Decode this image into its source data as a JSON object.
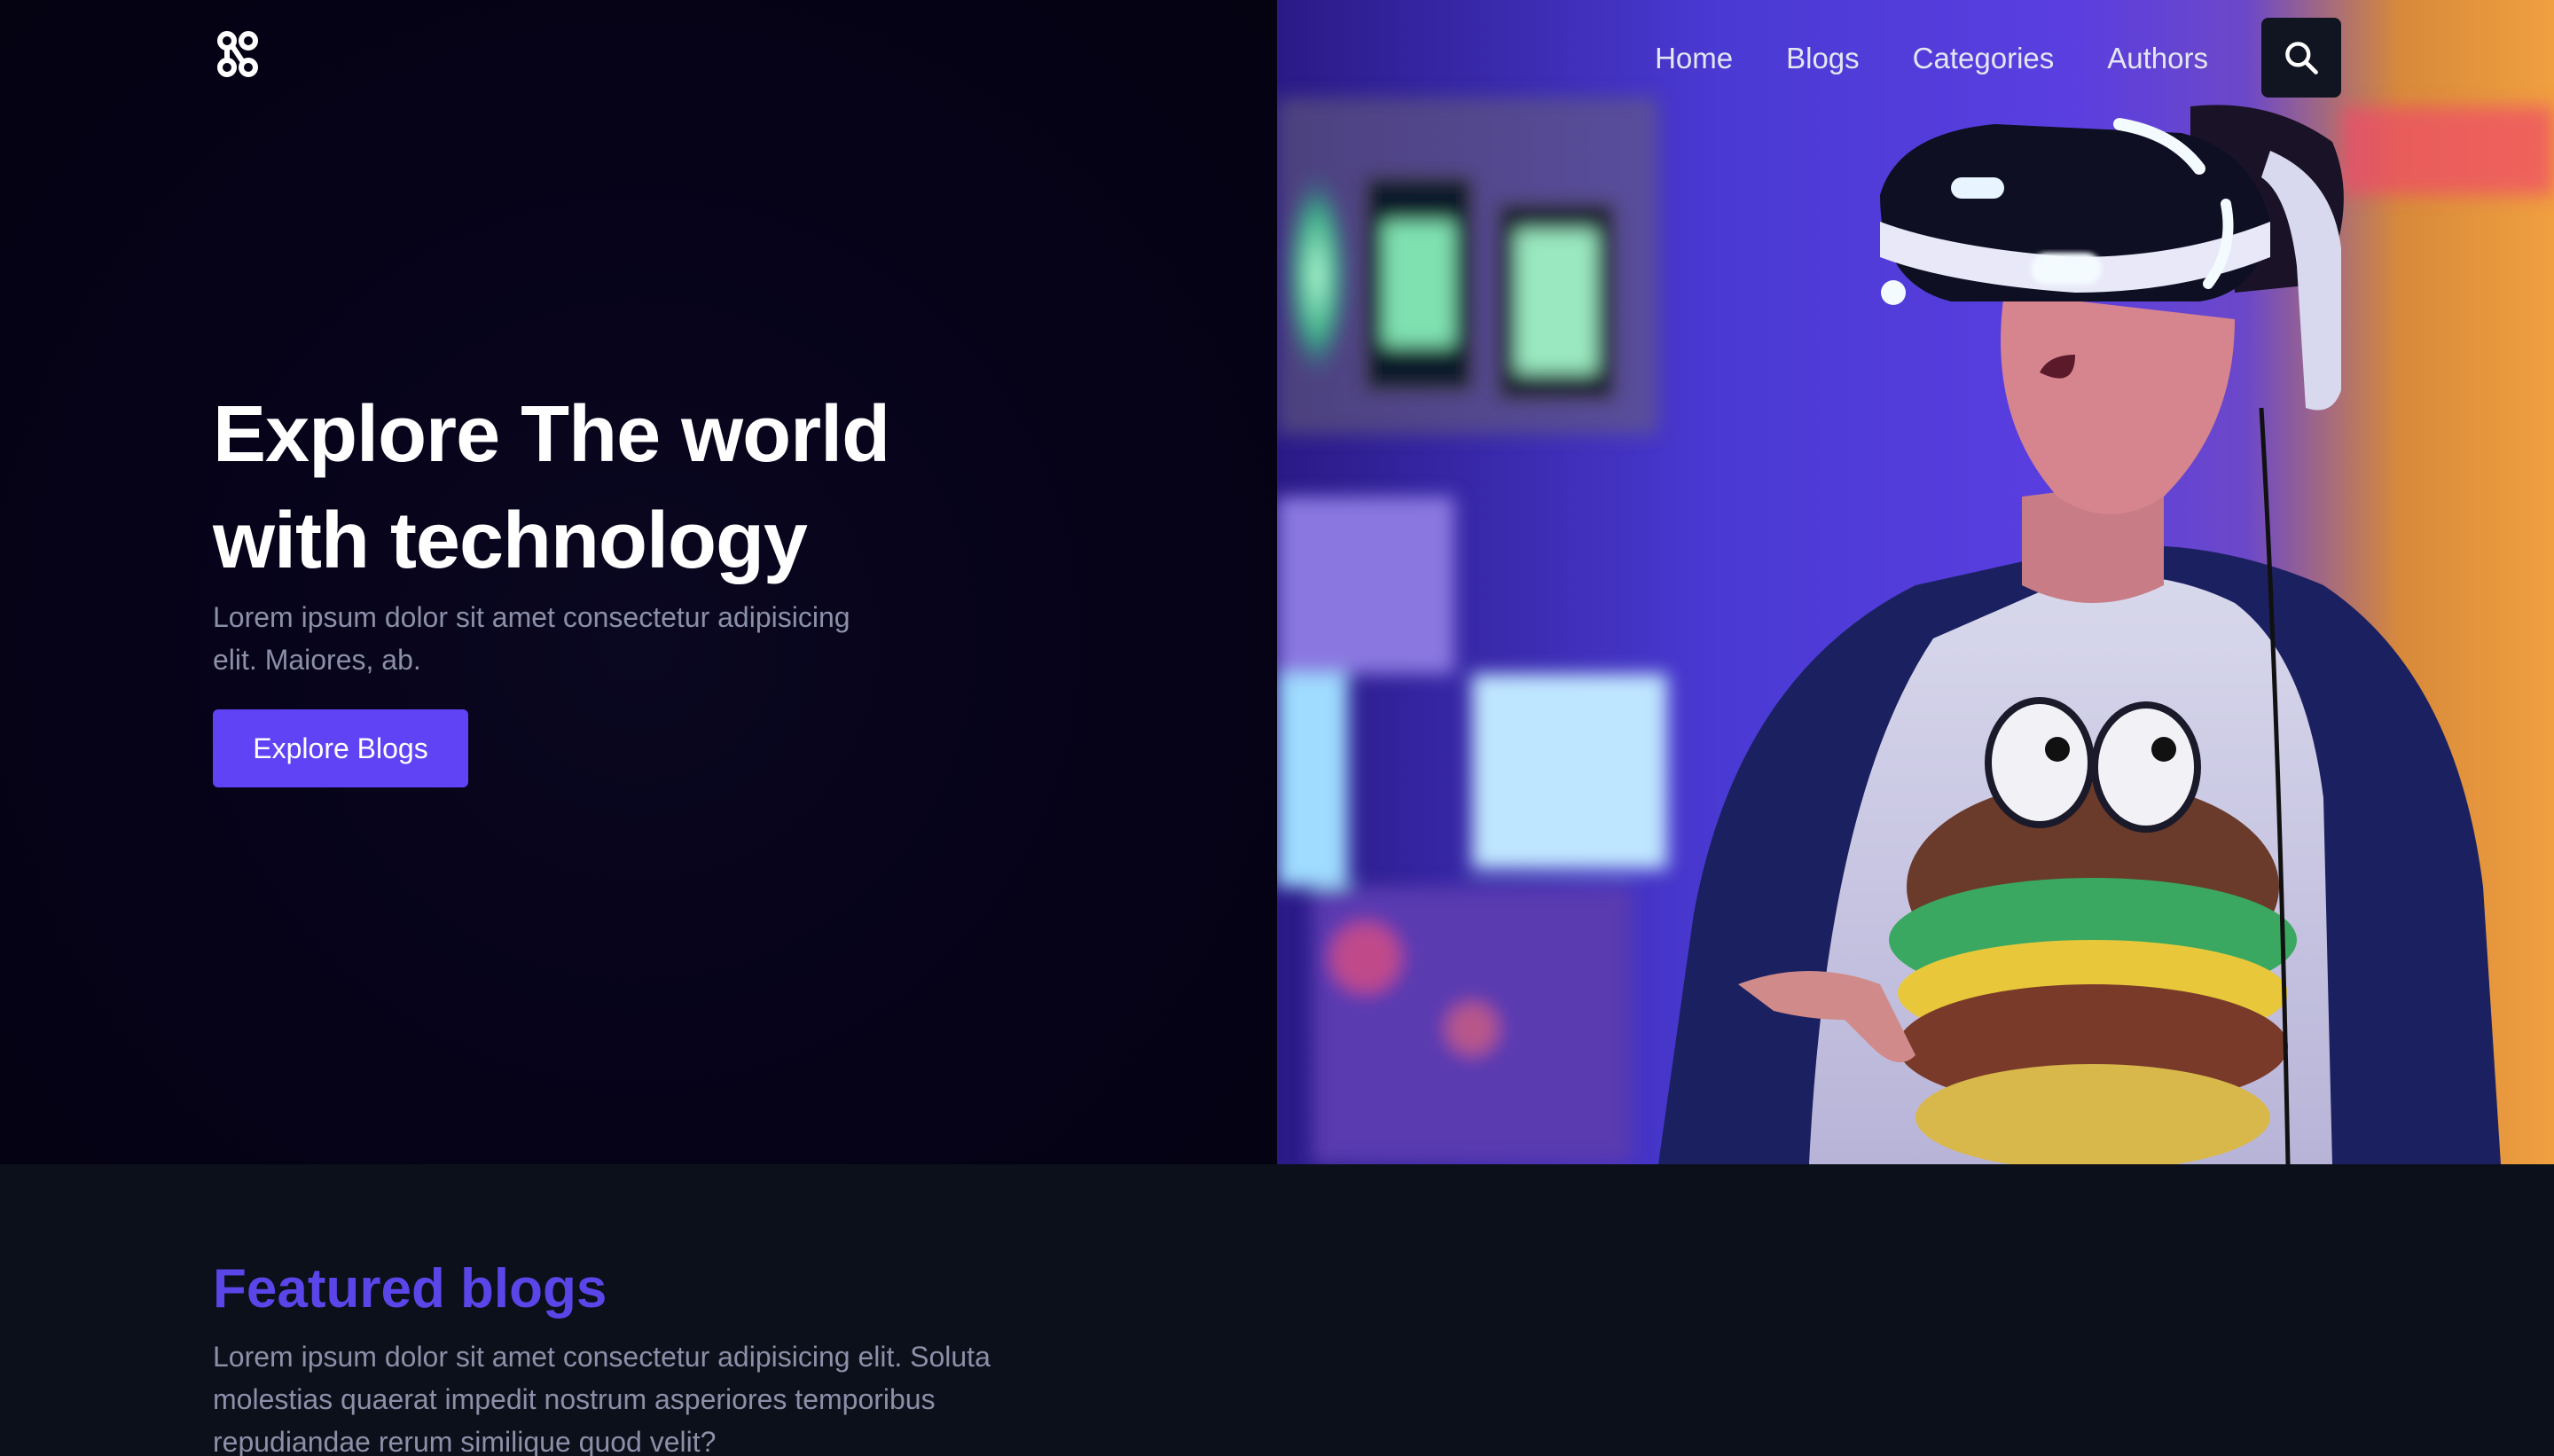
{
  "nav": {
    "logo_icon": "link-chain-icon",
    "links": [
      "Home",
      "Blogs",
      "Categories",
      "Authors"
    ],
    "search_icon": "search-icon"
  },
  "hero": {
    "title_line1": "Explore The world",
    "title_line2": "with technology",
    "subtitle": "Lorem ipsum dolor sit amet consectetur adipisicing elit. Maiores, ab.",
    "cta_label": "Explore Blogs",
    "image": "person-wearing-vr-headset-photo"
  },
  "featured": {
    "title": "Featured blogs",
    "description": "Lorem ipsum dolor sit amet consectetur adipisicing elit. Soluta molestias quaerat impedit nostrum asperiores temporibus repudiandae rerum similique quod velit?"
  },
  "colors": {
    "accent": "#6043f5",
    "featured_title": "#5b45e8",
    "hero_bg": "#06031a",
    "section_bg": "#0b101a",
    "muted_text": "#8b8fa8"
  }
}
